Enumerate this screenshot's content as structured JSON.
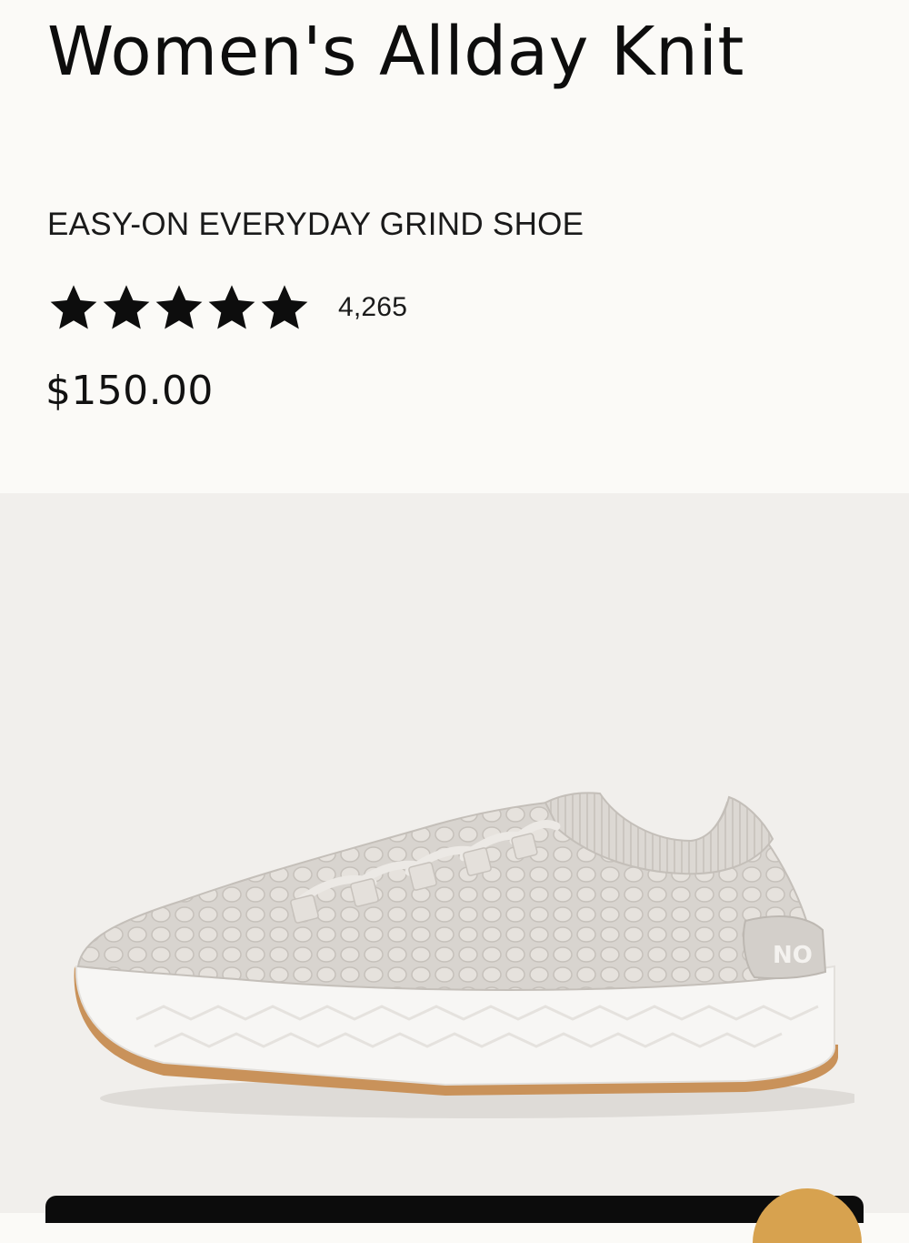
{
  "product": {
    "title": "Women's Allday Knit",
    "subtitle": "EASY-ON EVERYDAY GRIND SHOE",
    "rating_stars": 5,
    "review_count": "4,265",
    "price": "$150.00"
  },
  "image": {
    "description_icon": "shoe-product-image",
    "heel_text": "NO"
  },
  "colors": {
    "background": "#fbfaf7",
    "image_background": "#f1efec",
    "text": "#111111",
    "star": "#0d0d0d",
    "bottom_bar": "#0c0c0c",
    "accent": "#d7a24f"
  }
}
